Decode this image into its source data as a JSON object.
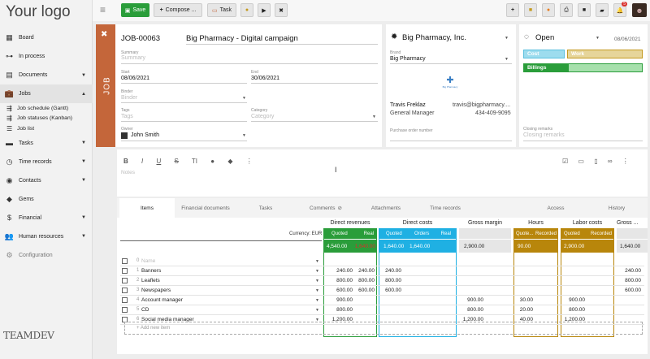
{
  "app": {
    "logo": "Your logo",
    "bottom_logo": "TEAMDEV"
  },
  "topbar": {
    "save_label": "Save",
    "compose_label": "Compose ...",
    "task_label": "Task",
    "notification_count": "5"
  },
  "sidebar": {
    "items": [
      {
        "label": "Board",
        "icon": "grid-icon"
      },
      {
        "label": "In process",
        "icon": "flow-icon"
      },
      {
        "label": "Documents",
        "icon": "document-icon"
      },
      {
        "label": "Jobs",
        "icon": "briefcase-icon"
      },
      {
        "label": "Tasks",
        "icon": "list-icon"
      },
      {
        "label": "Time records",
        "icon": "clock-icon"
      },
      {
        "label": "Contacts",
        "icon": "contact-icon"
      },
      {
        "label": "Gems",
        "icon": "gem-icon"
      },
      {
        "label": "Financial",
        "icon": "dollar-icon"
      },
      {
        "label": "Human resources",
        "icon": "people-icon"
      },
      {
        "label": "Configuration",
        "icon": "gear-icon"
      }
    ],
    "jobs_sub": [
      "Job schedule (Gantt)",
      "Job statuses (Kanban)",
      "Job list"
    ]
  },
  "job": {
    "strip_label": "JOB",
    "id": "JOB-00063",
    "title": "Big Pharmacy - Digital campaign",
    "summary_label": "Summary",
    "summary_placeholder": "Summary",
    "start_label": "Start",
    "start_value": "08/06/2021",
    "end_label": "End",
    "end_value": "30/06/2021",
    "binder_label": "Binder",
    "binder_placeholder": "Binder",
    "tags_label": "Tags",
    "tags_placeholder": "Tags",
    "category_label": "Category",
    "category_placeholder": "Category",
    "owner_label": "Owner",
    "owner_value": "John Smith"
  },
  "brand": {
    "client_name": "Big Pharmacy, Inc.",
    "brand_label": "Brand",
    "brand_value": "Big Pharmacy",
    "logo_caption": "Big Pharmacy",
    "contact_name": "Travis Freklaz",
    "contact_email": "travis@bigpharmacy....",
    "contact_role": "General Manager",
    "contact_phone": "434-409-9095",
    "po_label": "Purchase order number"
  },
  "status": {
    "value": "Open",
    "date": "08/06/2021",
    "bars": {
      "cost": "Cost",
      "work": "Work",
      "billings": "Billings"
    },
    "closing_label": "Closing remarks",
    "closing_placeholder": "Closing remarks",
    "colors": {
      "cost": "#5bc0de",
      "work": "#c49a1f",
      "billings": "#2a9d3a"
    }
  },
  "notes": {
    "placeholder": "Notes"
  },
  "tabs": [
    "Items",
    "Financial documents",
    "Tasks",
    "Comments",
    "Attachments",
    "Time records",
    "Access",
    "History"
  ],
  "items": {
    "currency_label": "Currency: EUR",
    "groups": {
      "direct_revenues": "Direct revenues",
      "direct_costs": "Direct costs",
      "gross_margin": "Gross margin",
      "hours": "Hours",
      "labor_costs": "Labor costs",
      "gross2": "Gross ..."
    },
    "sub": {
      "quoted": "Quoted",
      "real": "Real",
      "orders": "Orders",
      "quoted_short": "Quote...",
      "recorded": "Recorded"
    },
    "totals": {
      "rev_quoted": "4,540.00",
      "rev_real": "1,640.00",
      "cost_quoted": "1,640.00",
      "cost_orders": "1,640.00",
      "gm": "2,900.00",
      "hours_quoted": "90.00",
      "labor": "2,900.00",
      "gross2": "1,640.00"
    },
    "name_placeholder": "Name",
    "add_new": "+ Add new item",
    "rows": [
      {
        "n": "0",
        "name": "",
        "rq": "",
        "rr": "",
        "cq": "",
        "co": "",
        "gm": "",
        "hq": "",
        "lq": "",
        "g2": ""
      },
      {
        "n": "1",
        "name": "Banners",
        "rq": "240.00",
        "rr": "240.00",
        "cq": "240.00",
        "co": "",
        "gm": "",
        "hq": "",
        "lq": "",
        "g2": "240.00"
      },
      {
        "n": "2",
        "name": "Leaflets",
        "rq": "800.00",
        "rr": "800.00",
        "cq": "800.00",
        "co": "",
        "gm": "",
        "hq": "",
        "lq": "",
        "g2": "800.00"
      },
      {
        "n": "3",
        "name": "Newspapers",
        "rq": "600.00",
        "rr": "600.00",
        "cq": "600.00",
        "co": "",
        "gm": "",
        "hq": "",
        "lq": "",
        "g2": "600.00"
      },
      {
        "n": "4",
        "name": "Account manager",
        "rq": "900.00",
        "rr": "",
        "cq": "",
        "co": "",
        "gm": "900.00",
        "hq": "30.00",
        "lq": "900.00",
        "g2": ""
      },
      {
        "n": "5",
        "name": "CD",
        "rq": "800.00",
        "rr": "",
        "cq": "",
        "co": "",
        "gm": "800.00",
        "hq": "20.00",
        "lq": "800.00",
        "g2": ""
      },
      {
        "n": "6",
        "name": "Social media manager",
        "rq": "1,200.00",
        "rr": "",
        "cq": "",
        "co": "",
        "gm": "1,200.00",
        "hq": "40.00",
        "lq": "1,200.00",
        "g2": ""
      }
    ]
  }
}
